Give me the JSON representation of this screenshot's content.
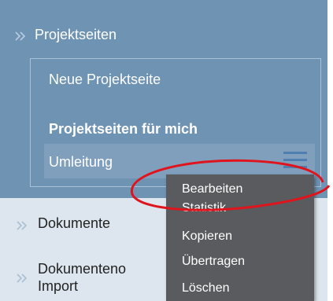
{
  "sidebar": {
    "section_title": "Projektseiten",
    "sub_items": [
      {
        "label": "Neue Projektseite"
      },
      {
        "label": "Projektseiten für mich"
      },
      {
        "label": "Umleitung"
      }
    ],
    "lower_items": [
      {
        "label": "Dokumente"
      },
      {
        "label_line1": "Dokumenteno",
        "label_line2": "Import"
      }
    ]
  },
  "context_menu": {
    "items": [
      "Bearbeiten",
      "Statistik",
      "Kopieren",
      "Übertragen",
      "Löschen"
    ]
  },
  "colors": {
    "panel": "#6f93b3",
    "menu_bg": "#595b5e",
    "annotation": "#e0141c"
  },
  "icons": {
    "section": "double-chevron-right-icon",
    "hamburger": "hamburger-menu-icon"
  }
}
